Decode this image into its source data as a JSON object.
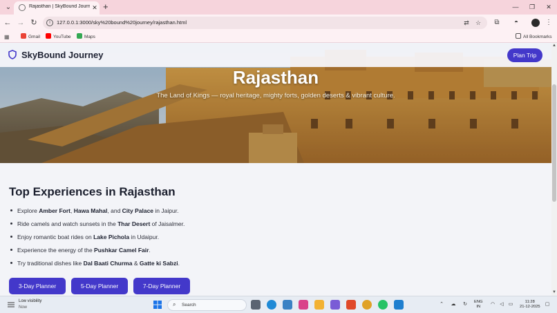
{
  "browser": {
    "tab_title": "Rajasthan | SkyBound Journey",
    "url": "127.0.0.1:3000/sky%20bound%20journey/rajasthan.html",
    "bookmarks": [
      {
        "label": "Gmail",
        "color": "#ea4335"
      },
      {
        "label": "YouTube",
        "color": "#ff0000"
      },
      {
        "label": "Maps",
        "color": "#34a853"
      }
    ],
    "all_bookmarks_label": "All Bookmarks"
  },
  "site": {
    "brand": "SkyBound Journey",
    "plan_trip_label": "Plan Trip",
    "accent_color": "#4338ca"
  },
  "hero": {
    "title": "Rajasthan",
    "subtitle": "The Land of Kings — royal heritage, mighty forts, golden deserts & vibrant culture."
  },
  "experiences": {
    "title": "Top Experiences in Rajasthan",
    "items": [
      [
        {
          "t": "Explore "
        },
        {
          "t": "Amber Fort",
          "b": true
        },
        {
          "t": ", "
        },
        {
          "t": "Hawa Mahal",
          "b": true
        },
        {
          "t": ", and "
        },
        {
          "t": "City Palace",
          "b": true
        },
        {
          "t": " in Jaipur."
        }
      ],
      [
        {
          "t": "Ride camels and watch sunsets in the "
        },
        {
          "t": "Thar Desert",
          "b": true
        },
        {
          "t": " of Jaisalmer."
        }
      ],
      [
        {
          "t": "Enjoy romantic boat rides on "
        },
        {
          "t": "Lake Pichola",
          "b": true
        },
        {
          "t": " in Udaipur."
        }
      ],
      [
        {
          "t": "Experience the energy of the "
        },
        {
          "t": "Pushkar Camel Fair",
          "b": true
        },
        {
          "t": "."
        }
      ],
      [
        {
          "t": "Try traditional dishes like "
        },
        {
          "t": "Dal Baati Churma",
          "b": true
        },
        {
          "t": " & "
        },
        {
          "t": "Gatte ki Sabzi",
          "b": true
        },
        {
          "t": "."
        }
      ]
    ]
  },
  "planners": [
    "3-Day Planner",
    "5-Day Planner",
    "7-Day Planner"
  ],
  "taskbar": {
    "weather_title": "Low visibility",
    "weather_sub": "Now",
    "search_placeholder": "Search",
    "lang_line1": "ENG",
    "lang_line2": "IN",
    "time": "11:28",
    "date": "21-12-2025"
  }
}
